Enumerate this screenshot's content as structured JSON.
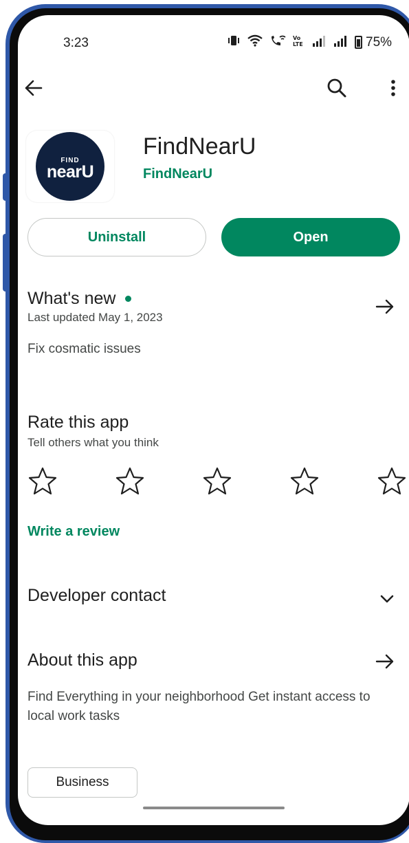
{
  "status_bar": {
    "time": "3:23",
    "battery": "75%",
    "icons": [
      "vibrate-icon",
      "wifi-icon",
      "wifi-calling-icon",
      "volte-icon",
      "signal-icon",
      "signal-icon",
      "battery-icon"
    ]
  },
  "top_bar": {
    "icons": [
      "back-arrow-icon",
      "search-icon",
      "more-vert-icon"
    ]
  },
  "app": {
    "name": "FindNearU",
    "developer": "FindNearU",
    "icon_logo_top": "FIND",
    "icon_logo_main": "nearU"
  },
  "actions": {
    "uninstall_label": "Uninstall",
    "open_label": "Open"
  },
  "whats_new": {
    "title": "What's new",
    "updated": "Last updated May 1, 2023",
    "body": "Fix cosmatic issues"
  },
  "rate": {
    "title": "Rate this app",
    "subtitle": "Tell others what you think",
    "star_count": 5,
    "write_review": "Write a review"
  },
  "developer_contact": {
    "title": "Developer contact"
  },
  "about": {
    "title": "About this app",
    "body": "Find Everything in your neighborhood Get instant access to local work tasks"
  },
  "category_chip": "Business",
  "colors": {
    "accent": "#01875f",
    "frame": "#2f58a8",
    "icon_bg": "#10213f"
  }
}
